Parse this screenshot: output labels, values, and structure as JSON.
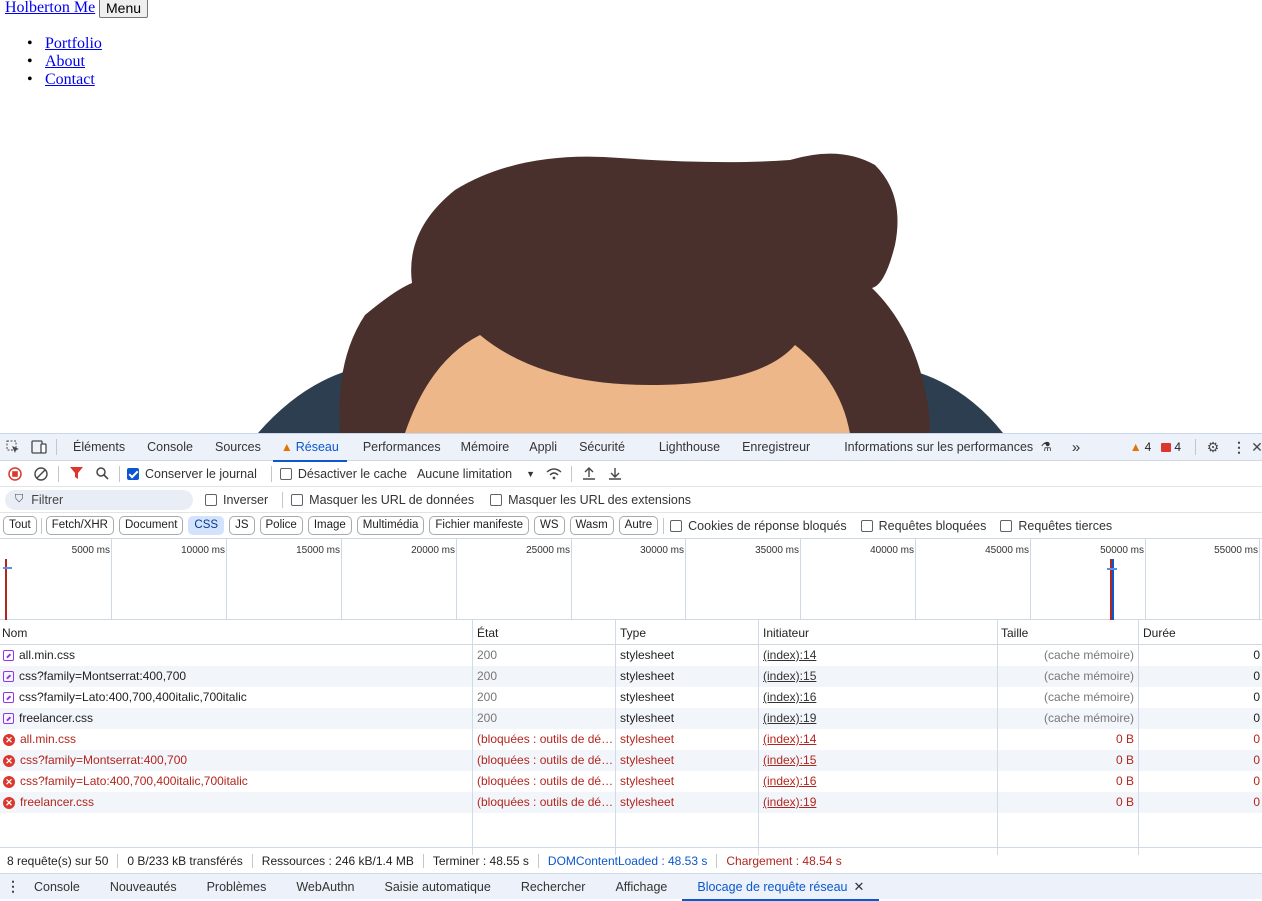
{
  "page": {
    "brand": "Holberton Me",
    "menu_button": "Menu",
    "nav": [
      "Portfolio",
      "About",
      "Contact"
    ]
  },
  "devtools": {
    "tabs": [
      "Éléments",
      "Console",
      "Sources",
      "Réseau",
      "Performances",
      "Mémoire",
      "Appli",
      "Sécurité",
      "Lighthouse",
      "Enregistreur",
      "Informations sur les performances"
    ],
    "active_tab": "Réseau",
    "more_tabs": "»",
    "warnings_count": "4",
    "errors_count": "4",
    "toolbar": {
      "preserve_log": "Conserver le journal",
      "disable_cache": "Désactiver le cache",
      "throttling": "Aucune limitation"
    },
    "filter": {
      "placeholder": "Filtrer",
      "invert": "Inverser",
      "hide_data_urls": "Masquer les URL de données",
      "hide_ext_urls": "Masquer les URL des extensions"
    },
    "chips": [
      "Tout",
      "Fetch/XHR",
      "Document",
      "CSS",
      "JS",
      "Police",
      "Image",
      "Multimédia",
      "Fichier manifeste",
      "WS",
      "Wasm",
      "Autre"
    ],
    "active_chip": "CSS",
    "chip_checks": [
      "Cookies de réponse bloqués",
      "Requêtes bloquées",
      "Requêtes tierces"
    ],
    "timeline_ticks": [
      "5000 ms",
      "10000 ms",
      "15000 ms",
      "20000 ms",
      "25000 ms",
      "30000 ms",
      "35000 ms",
      "40000 ms",
      "45000 ms",
      "50000 ms",
      "55000 ms"
    ],
    "columns": [
      "Nom",
      "État",
      "Type",
      "Initiateur",
      "Taille",
      "Durée"
    ],
    "rows": [
      {
        "name": "all.min.css",
        "state": "200",
        "type": "stylesheet",
        "initiator": "(index):14",
        "size": "(cache mémoire)",
        "duration": "0",
        "error": false
      },
      {
        "name": "css?family=Montserrat:400,700",
        "state": "200",
        "type": "stylesheet",
        "initiator": "(index):15",
        "size": "(cache mémoire)",
        "duration": "0",
        "error": false
      },
      {
        "name": "css?family=Lato:400,700,400italic,700italic",
        "state": "200",
        "type": "stylesheet",
        "initiator": "(index):16",
        "size": "(cache mémoire)",
        "duration": "0",
        "error": false
      },
      {
        "name": "freelancer.css",
        "state": "200",
        "type": "stylesheet",
        "initiator": "(index):19",
        "size": "(cache mémoire)",
        "duration": "0",
        "error": false
      },
      {
        "name": "all.min.css",
        "state": "(bloquées : outils de dé…",
        "type": "stylesheet",
        "initiator": "(index):14",
        "size": "0 B",
        "duration": "0",
        "error": true
      },
      {
        "name": "css?family=Montserrat:400,700",
        "state": "(bloquées : outils de dé…",
        "type": "stylesheet",
        "initiator": "(index):15",
        "size": "0 B",
        "duration": "0",
        "error": true
      },
      {
        "name": "css?family=Lato:400,700,400italic,700italic",
        "state": "(bloquées : outils de dé…",
        "type": "stylesheet",
        "initiator": "(index):16",
        "size": "0 B",
        "duration": "0",
        "error": true
      },
      {
        "name": "freelancer.css",
        "state": "(bloquées : outils de dé…",
        "type": "stylesheet",
        "initiator": "(index):19",
        "size": "0 B",
        "duration": "0",
        "error": true
      }
    ],
    "status": {
      "requests": "8 requête(s) sur 50",
      "transferred": "0 B/233 kB transférés",
      "resources": "Ressources : 246 kB/1.4 MB",
      "finish": "Terminer : 48.55 s",
      "dcl": "DOMContentLoaded : 48.53 s",
      "load": "Chargement : 48.54 s"
    },
    "drawer_tabs": [
      "Console",
      "Nouveautés",
      "Problèmes",
      "WebAuthn",
      "Saisie automatique",
      "Rechercher",
      "Affichage",
      "Blocage de requête réseau"
    ],
    "drawer_active": "Blocage de requête réseau"
  },
  "colors": {
    "hair": "#4a302c",
    "skin": "#edb78a",
    "shirt": "#2c3e50",
    "accent": "#0b57d0",
    "error": "#b3261e"
  }
}
